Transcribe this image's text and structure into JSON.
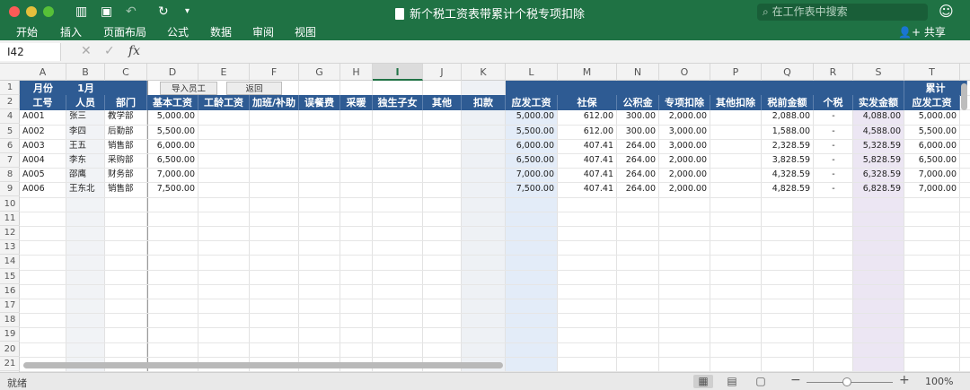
{
  "window": {
    "title": "新个税工资表带累计个税专项扣除",
    "search_placeholder": "在工作表中搜索",
    "share_label": "共享"
  },
  "ribbon_tabs": [
    "开始",
    "插入",
    "页面布局",
    "公式",
    "数据",
    "审阅",
    "视图"
  ],
  "formula_bar": {
    "name_box": "I42",
    "cancel": "✕",
    "enter": "✓",
    "fx": "fx"
  },
  "column_letters": [
    "A",
    "B",
    "C",
    "D",
    "E",
    "F",
    "G",
    "H",
    "I",
    "J",
    "K",
    "L",
    "M",
    "N",
    "O",
    "P",
    "Q",
    "R",
    "S",
    "T"
  ],
  "selected_column": "I",
  "row_numbers": [
    "1",
    "2",
    "4",
    "5",
    "6",
    "7",
    "8",
    "9",
    "10",
    "11",
    "12",
    "13",
    "14",
    "15",
    "16",
    "17",
    "18",
    "19",
    "20",
    "21"
  ],
  "row1": {
    "month_label": "月份",
    "month_value": "1月",
    "import_button": "导入员工",
    "back_button": "返回",
    "cumulative": "累计"
  },
  "headers": [
    "工号",
    "人员",
    "部门",
    "基本工资",
    "工龄工资",
    "加班/补助",
    "误餐费",
    "采暖",
    "独生子女",
    "其他",
    "扣款",
    "应发工资",
    "社保",
    "公积金",
    "专项扣除",
    "其他扣除",
    "税前金额",
    "个税",
    "实发金额",
    "应发工资"
  ],
  "rows": [
    {
      "id": "A001",
      "name": "张三",
      "dept": "教学部",
      "base": "5,000.00",
      "gross": "5,000.00",
      "social": "612.00",
      "fund": "300.00",
      "special": "2,000.00",
      "pretax": "2,088.00",
      "tax": "-",
      "net": "4,088.00",
      "cum_gross": "5,000.00"
    },
    {
      "id": "A002",
      "name": "李四",
      "dept": "后勤部",
      "base": "5,500.00",
      "gross": "5,500.00",
      "social": "612.00",
      "fund": "300.00",
      "special": "3,000.00",
      "pretax": "1,588.00",
      "tax": "-",
      "net": "4,588.00",
      "cum_gross": "5,500.00"
    },
    {
      "id": "A003",
      "name": "王五",
      "dept": "销售部",
      "base": "6,000.00",
      "gross": "6,000.00",
      "social": "407.41",
      "fund": "264.00",
      "special": "3,000.00",
      "pretax": "2,328.59",
      "tax": "-",
      "net": "5,328.59",
      "cum_gross": "6,000.00"
    },
    {
      "id": "A004",
      "name": "李东",
      "dept": "采购部",
      "base": "6,500.00",
      "gross": "6,500.00",
      "social": "407.41",
      "fund": "264.00",
      "special": "2,000.00",
      "pretax": "3,828.59",
      "tax": "-",
      "net": "5,828.59",
      "cum_gross": "6,500.00"
    },
    {
      "id": "A005",
      "name": "邵鹰",
      "dept": "财务部",
      "base": "7,000.00",
      "gross": "7,000.00",
      "social": "407.41",
      "fund": "264.00",
      "special": "2,000.00",
      "pretax": "4,328.59",
      "tax": "-",
      "net": "6,328.59",
      "cum_gross": "7,000.00"
    },
    {
      "id": "A006",
      "name": "王东北",
      "dept": "销售部",
      "base": "7,500.00",
      "gross": "7,500.00",
      "social": "407.41",
      "fund": "264.00",
      "special": "2,000.00",
      "pretax": "4,828.59",
      "tax": "-",
      "net": "6,828.59",
      "cum_gross": "7,000.00"
    }
  ],
  "status": {
    "ready": "就绪",
    "zoom": "100%"
  },
  "colors": {
    "accent": "#1f7244",
    "header_blue": "#2e5b93",
    "col_l_tint": "#e3ecf8",
    "col_s_tint": "#ece6f3",
    "col_k_tint": "#eef1f5"
  },
  "icons": [
    "sidebar-toggle-icon",
    "save-icon",
    "undo-icon",
    "redo-icon",
    "customize-icon",
    "search-icon",
    "smiley-icon",
    "share-person-icon",
    "normal-view-icon",
    "page-layout-view-icon",
    "page-break-view-icon"
  ]
}
